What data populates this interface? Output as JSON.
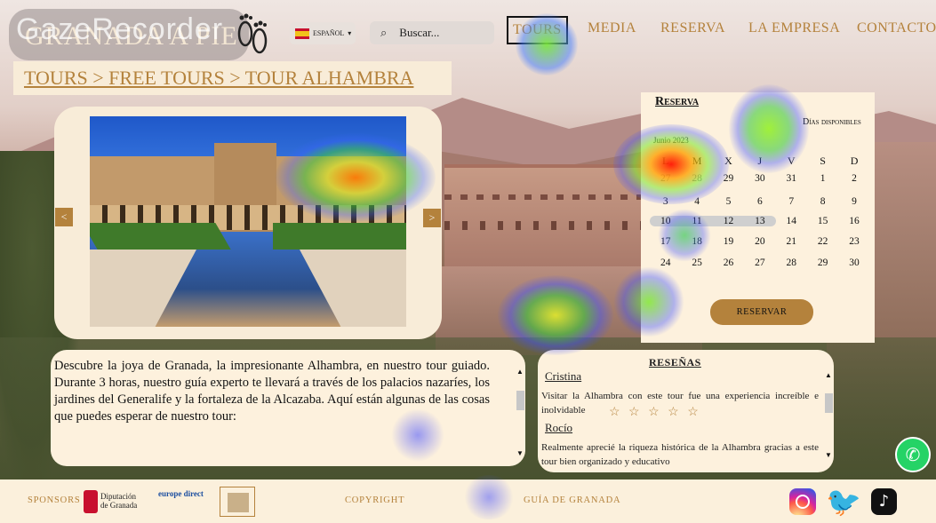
{
  "app": {
    "watermark": "GazeRecorder"
  },
  "logo": {
    "text": "GRANADA A PIE"
  },
  "language": {
    "label": "ESPAÑOL",
    "flag_icon": "spain-flag-icon",
    "caret": "▾"
  },
  "search": {
    "placeholder": "Buscar...",
    "icon": "search-icon"
  },
  "nav": {
    "items": [
      "TOURS",
      "MEDIA",
      "RESERVA",
      "LA EMPRESA",
      "CONTACTO"
    ],
    "active": "TOURS"
  },
  "breadcrumb": {
    "text": "TOURS > FREE TOURS > TOUR ALHAMBRA"
  },
  "carousel": {
    "prev": "<",
    "next": ">"
  },
  "description": {
    "text": "Descubre la joya de Granada, la impresionante Alhambra, en nuestro tour guiado. Durante 3 horas, nuestro guía experto te llevará a través de los palacios nazaríes, los jardines del Generalife y la fortaleza de la Alcazaba. Aquí están algunas de las cosas que puedes esperar de nuestro tour:"
  },
  "reservation": {
    "title": "Reserva",
    "available_label": "Días disponibles",
    "month": "Junio 2023",
    "weekdays": [
      "L",
      "M",
      "X",
      "J",
      "V",
      "S",
      "D"
    ],
    "weeks": [
      [
        "27",
        "28",
        "29",
        "30",
        "31",
        "1",
        "2"
      ],
      [
        "3",
        "4",
        "5",
        "6",
        "7",
        "8",
        "9"
      ],
      [
        "10",
        "11",
        "12",
        "13",
        "14",
        "15",
        "16"
      ],
      [
        "17",
        "18",
        "19",
        "20",
        "21",
        "22",
        "23"
      ],
      [
        "24",
        "25",
        "26",
        "27",
        "28",
        "29",
        "30"
      ]
    ],
    "selected_range": [
      "10",
      "11",
      "12",
      "13"
    ],
    "button": "RESERVAR"
  },
  "reviews": {
    "title": "RESEÑAS",
    "items": [
      {
        "name": "Cristina",
        "text": "Visitar la Alhambra con este tour fue una experiencia increíble e inolvidable",
        "stars": "☆ ☆ ☆ ☆ ☆"
      },
      {
        "name": "Rocío",
        "text": "Realmente aprecié la riqueza histórica de la Alhambra gracias a este tour bien organizado y educativo"
      }
    ]
  },
  "footer": {
    "sponsors_label": "SPONSORS",
    "sponsor1": "Diputación de Granada",
    "sponsor2": "europe direct",
    "copyright": "COPYRIGHT",
    "guide": "GUÍA DE GRANADA"
  },
  "colors": {
    "accent": "#b4823c",
    "panel": "#fdf1dd"
  }
}
